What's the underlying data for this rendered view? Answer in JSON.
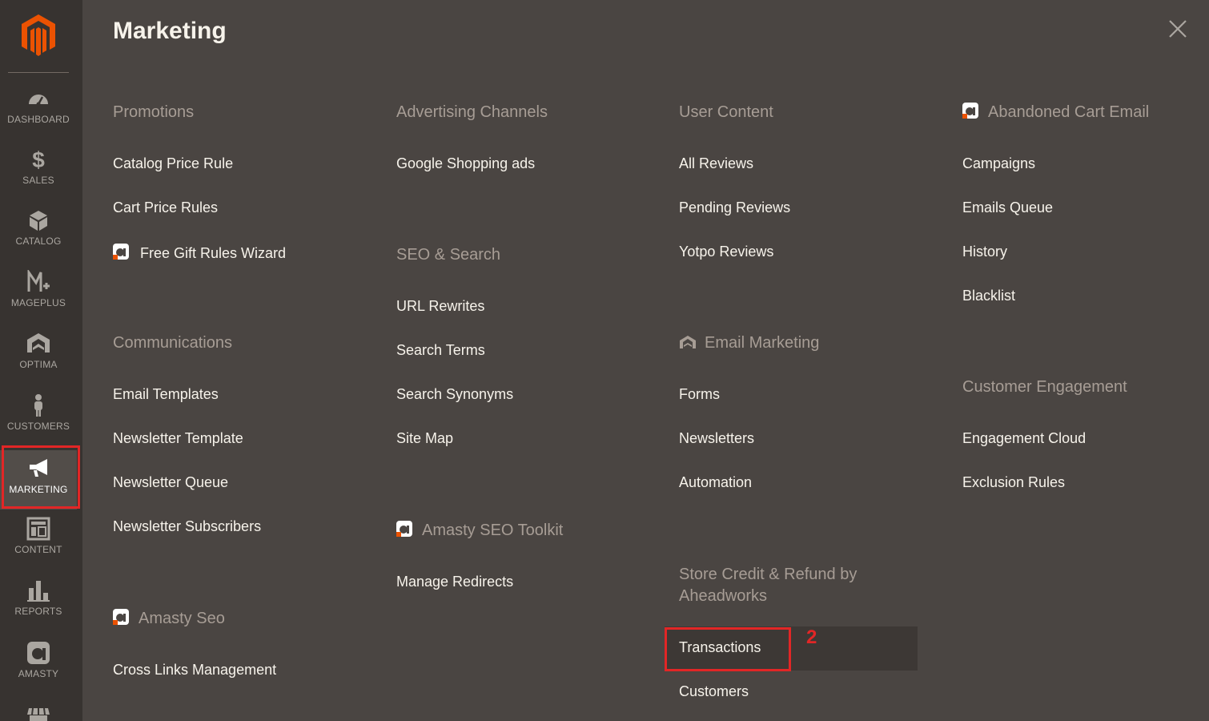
{
  "sidebar": {
    "items": [
      {
        "label": "DASHBOARD"
      },
      {
        "label": "SALES"
      },
      {
        "label": "CATALOG"
      },
      {
        "label": "MAGEPLUS"
      },
      {
        "label": "OPTIMA"
      },
      {
        "label": "CUSTOMERS"
      },
      {
        "label": "MARKETING"
      },
      {
        "label": "CONTENT"
      },
      {
        "label": "REPORTS"
      },
      {
        "label": "AMASTY"
      }
    ],
    "active_marker": "1"
  },
  "panel": {
    "title": "Marketing",
    "annotation_marker": "2",
    "columns": [
      {
        "sections": [
          {
            "title": "Promotions",
            "links": [
              "Catalog Price Rule",
              "Cart Price Rules",
              "Free Gift Rules Wizard"
            ]
          },
          {
            "title": "Communications",
            "links": [
              "Email Templates",
              "Newsletter Template",
              "Newsletter Queue",
              "Newsletter Subscribers"
            ]
          },
          {
            "title": "Amasty Seo",
            "links": [
              "Cross Links Management"
            ]
          }
        ]
      },
      {
        "sections": [
          {
            "title": "Advertising Channels",
            "links": [
              "Google Shopping ads"
            ]
          },
          {
            "title": "SEO & Search",
            "links": [
              "URL Rewrites",
              "Search Terms",
              "Search Synonyms",
              "Site Map"
            ]
          },
          {
            "title": "Amasty SEO Toolkit",
            "links": [
              "Manage Redirects"
            ]
          }
        ]
      },
      {
        "sections": [
          {
            "title": "User Content",
            "links": [
              "All Reviews",
              "Pending Reviews",
              "Yotpo Reviews"
            ]
          },
          {
            "title": "Email Marketing",
            "links": [
              "Forms",
              "Newsletters",
              "Automation"
            ]
          },
          {
            "title_line1": "Store Credit & Refund by",
            "title_line2": "Aheadworks",
            "links": [
              "Transactions",
              "Customers"
            ]
          }
        ]
      },
      {
        "sections": [
          {
            "title": "Abandoned Cart Email",
            "links": [
              "Campaigns",
              "Emails Queue",
              "History",
              "Blacklist"
            ]
          },
          {
            "title": "Customer Engagement",
            "links": [
              "Engagement Cloud",
              "Exclusion Rules"
            ]
          }
        ]
      }
    ]
  },
  "colors": {
    "sidebar_bg": "#373330",
    "panel_bg": "#4a4542",
    "brand_orange": "#eb5202",
    "annotation_red": "#e22626"
  },
  "icons": [
    "magento-logo-icon",
    "dashboard-icon",
    "dollar-icon",
    "box-icon",
    "mageplus-icon",
    "optima-icon",
    "person-icon",
    "megaphone-icon",
    "content-icon",
    "bar-chart-icon",
    "amasty-icon",
    "store-icon",
    "close-icon"
  ]
}
